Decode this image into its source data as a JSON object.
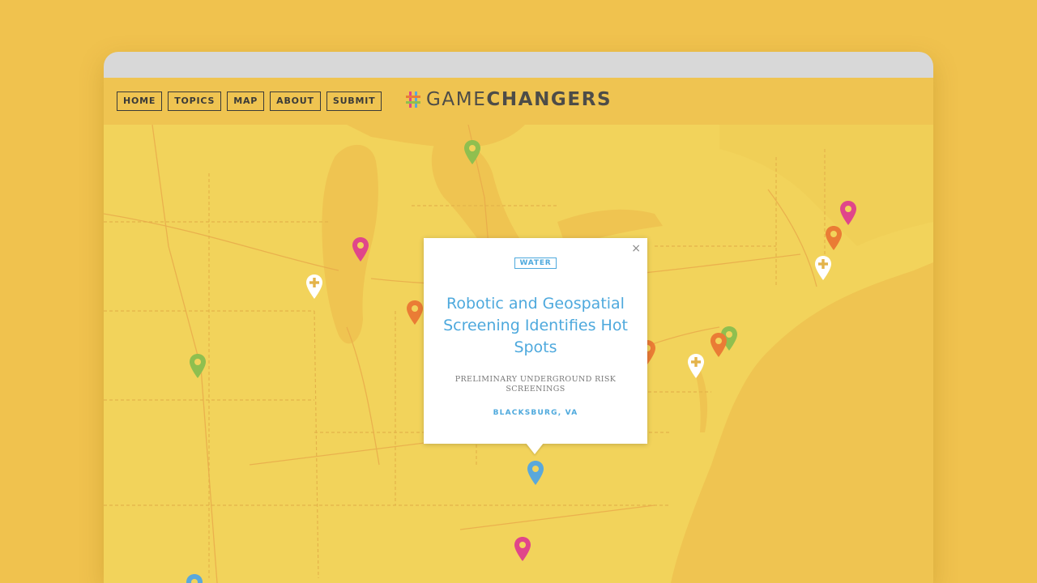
{
  "nav": {
    "items": [
      "HOME",
      "TOPICS",
      "MAP",
      "ABOUT",
      "SUBMIT"
    ]
  },
  "logo": {
    "part1": "GAME",
    "part2": "CHANGERS"
  },
  "popup": {
    "tag": "WATER",
    "title": "Robotic and Geospatial Screening Identifies Hot Spots",
    "subtitle": "PRELIMINARY UNDERGROUND RISK SCREENINGS",
    "location": "BLACKSBURG, VA",
    "close_symbol": "×"
  },
  "colors": {
    "background": "#f0c24e",
    "map_land": "#f2d35b",
    "map_water": "#efc451",
    "pin_green": "#8fbf4f",
    "pin_pink": "#e0468a",
    "pin_orange": "#ea7c35",
    "pin_blue": "#5aa8db",
    "pin_white": "#ffffff",
    "accent_blue": "#4ea9dd",
    "text_dark": "#3a3a38"
  }
}
